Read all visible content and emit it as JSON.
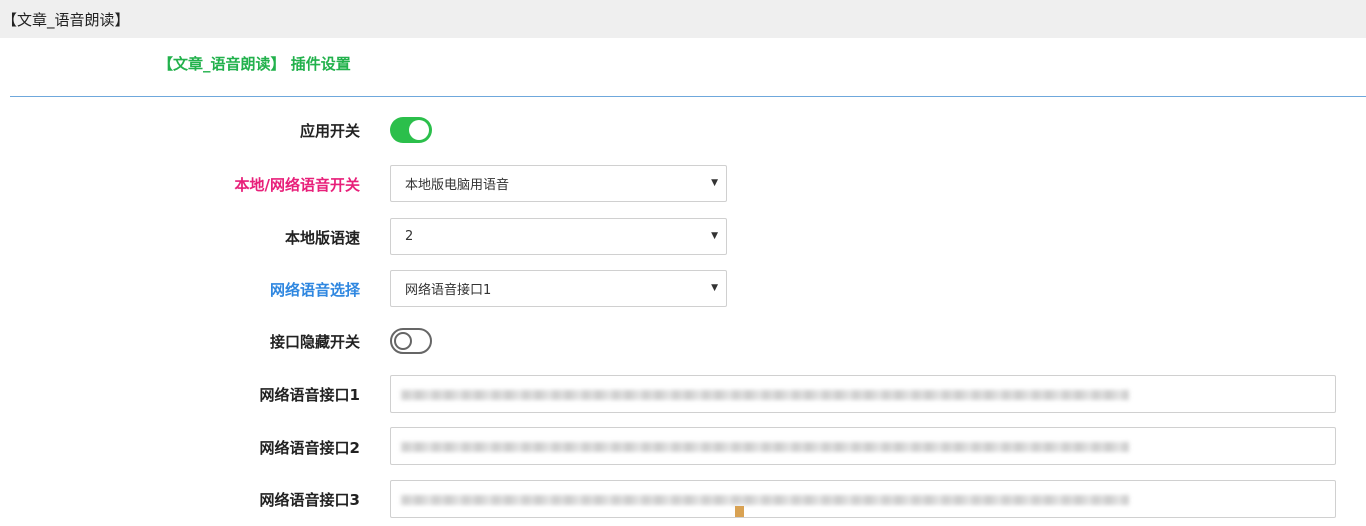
{
  "window": {
    "title": "【文章_语音朗读】"
  },
  "plugin": {
    "title": "【文章_语音朗读】 插件设置"
  },
  "form": {
    "app_switch": {
      "label": "应用开关",
      "state": "on"
    },
    "voice_source": {
      "label": "本地/网络语音开关",
      "value": "本地版电脑用语音"
    },
    "local_speed": {
      "label": "本地版语速",
      "value": "2"
    },
    "net_voice_select": {
      "label": "网络语音选择",
      "value": "网络语音接口1"
    },
    "hide_api_switch": {
      "label": "接口隐藏开关",
      "state": "off"
    },
    "api1": {
      "label": "网络语音接口1",
      "value": ""
    },
    "api2": {
      "label": "网络语音接口2",
      "value": ""
    },
    "api3": {
      "label": "网络语音接口3",
      "value": ""
    }
  },
  "colors": {
    "accent_green": "#22b14c",
    "toggle_on": "#2bbf4b",
    "label_pink": "#e8207a",
    "label_blue": "#2f87e0",
    "divider": "#6fa8dc"
  }
}
